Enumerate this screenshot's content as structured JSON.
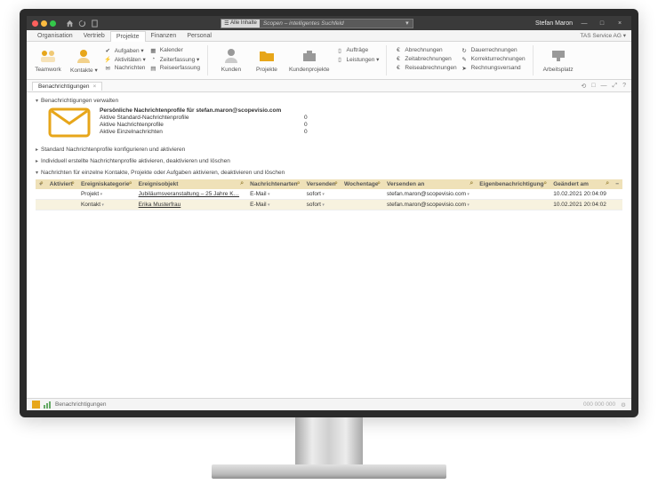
{
  "titlebar": {
    "search_pill": "Alle Inhalte",
    "search_placeholder": "Scopen – intelligentes Suchfeld",
    "username": "Stefan Maron",
    "min": "—",
    "max": "□",
    "close": "×"
  },
  "menus": {
    "items": [
      "Organisation",
      "Vertrieb",
      "Projekte",
      "Finanzen",
      "Personal"
    ],
    "active_index": 2,
    "company": "TAS Service AG"
  },
  "ribbon": {
    "big": [
      {
        "label": "Teamwork",
        "icon": "teamwork"
      },
      {
        "label": "Kontakte ▾",
        "icon": "contacts"
      }
    ],
    "col1": [
      {
        "label": "Aufgaben ▾",
        "icon": "check"
      },
      {
        "label": "Aktivitäten ▾",
        "icon": "bolt"
      },
      {
        "label": "Nachrichten",
        "icon": "mail"
      }
    ],
    "col2": [
      {
        "label": "Kalender",
        "icon": "calendar"
      },
      {
        "label": "Zeiterfassung ▾",
        "icon": "clock"
      },
      {
        "label": "Reiseerfassung",
        "icon": "car"
      }
    ],
    "big2": [
      {
        "label": "Kunden",
        "icon": "user"
      },
      {
        "label": "Projekte",
        "icon": "folder"
      },
      {
        "label": "Kundenprojekte",
        "icon": "briefcase"
      }
    ],
    "col3": [
      {
        "label": "Aufträge",
        "icon": "doc"
      },
      {
        "label": "Leistungen ▾",
        "icon": "doc"
      },
      {
        "label": "",
        "icon": ""
      }
    ],
    "col4": [
      {
        "label": "Abrechnungen",
        "icon": "euro"
      },
      {
        "label": "Zeitabrechnungen",
        "icon": "euro"
      },
      {
        "label": "Reiseabrechnungen",
        "icon": "euro"
      }
    ],
    "col5": [
      {
        "label": "Dauerrechnungen",
        "icon": "repeat"
      },
      {
        "label": "Korrekturrechnungen",
        "icon": "edit"
      },
      {
        "label": "Rechnungsversand",
        "icon": "send"
      }
    ],
    "big3": [
      {
        "label": "Arbeitsplatz",
        "icon": "desk"
      }
    ]
  },
  "tab": {
    "label": "Benachrichtigungen",
    "close": "×",
    "right_icons": [
      "⟲",
      "□",
      "—",
      "⤢",
      "?"
    ]
  },
  "sections": {
    "s1": "Benachrichtigungen verwalten",
    "profile_title": "Persönliche Nachrichtenprofile für stefan.maron@scopevisio.com",
    "rows": [
      {
        "label": "Aktive Standard-Nachrichtenprofile",
        "value": "0"
      },
      {
        "label": "Aktive Nachrichtenprofile",
        "value": "0"
      },
      {
        "label": "Aktive Einzelnachrichten",
        "value": "0"
      }
    ],
    "s2": "Standard Nachrichtenprofile konfigurieren und aktivieren",
    "s3": "Individuell erstellte Nachrichtenprofile aktivieren, deaktivieren und löschen",
    "s4": "Nachrichten für einzelne Kontakte, Projekte oder Aufgaben aktivieren, deaktivieren und löschen"
  },
  "table": {
    "headers": [
      "Aktiviert",
      "Ereigniskategorie",
      "Ereignisobjekt",
      "Nachrichtenarten",
      "Versenden",
      "Wochentage",
      "Versenden an",
      "Eigenbenachrichtigung",
      "Geändert am"
    ],
    "rows": [
      {
        "kategorie": "Projekt",
        "objekt": "Jubiläumsveranstaltung – 25 Jahre K…",
        "art": "E-Mail",
        "versenden": "sofort",
        "wochentage": "",
        "an": "stefan.maron@scopevisio.com",
        "eigen": "",
        "geaendert": "10.02.2021 20:04:09"
      },
      {
        "kategorie": "Kontakt",
        "objekt": "Erika Musterfrau",
        "art": "E-Mail",
        "versenden": "sofort",
        "wochentage": "",
        "an": "stefan.maron@scopevisio.com",
        "eigen": "",
        "geaendert": "10.02.2021 20:04:02"
      }
    ]
  },
  "status": {
    "crumb": "Benachrichtigungen",
    "right": "000 000 000"
  },
  "colors": {
    "accent_yellow": "#e7a61a",
    "header_tan": "#efe1b8"
  }
}
